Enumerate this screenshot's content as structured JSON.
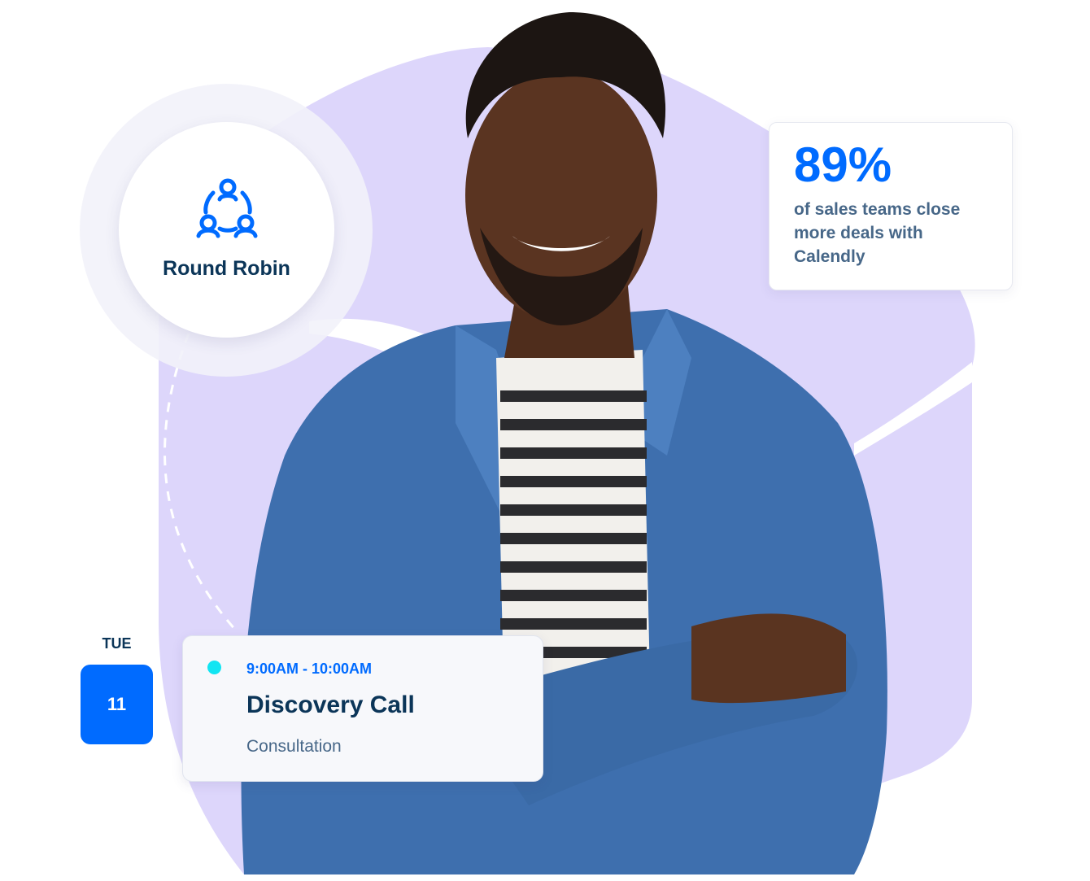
{
  "round_robin": {
    "label": "Round Robin",
    "icon": "group-rotation-icon"
  },
  "stat": {
    "value": "89%",
    "text": "of sales teams close more deals with Calendly"
  },
  "calendar": {
    "day": "TUE",
    "date": "11"
  },
  "event": {
    "time": "9:00AM - 10:00AM",
    "title": "Discovery Call",
    "type": "Consultation",
    "status_color": "#12e5f2"
  },
  "colors": {
    "accent": "#006bff",
    "navy": "#0b3558",
    "lavender": "#ddd6fb"
  }
}
